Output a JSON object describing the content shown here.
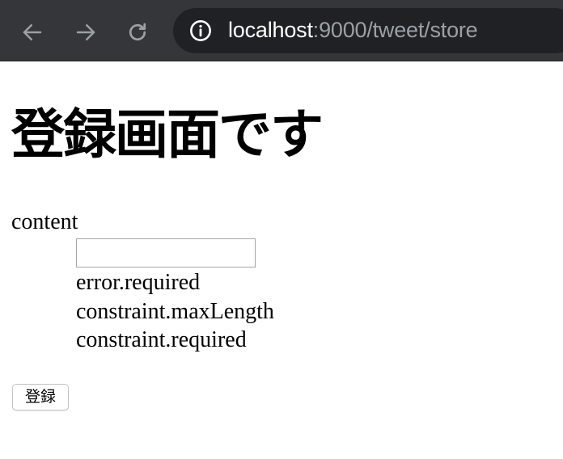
{
  "browser": {
    "url_host": "localhost",
    "url_rest": ":9000/tweet/store",
    "icons": {
      "back": "arrow-left-icon",
      "forward": "arrow-right-icon",
      "reload": "reload-icon",
      "site_info": "info-circle-icon"
    },
    "colors": {
      "toolbar": "#35363a",
      "omnibox": "#202124",
      "icon": "#9aa0a6"
    }
  },
  "page": {
    "title": "登録画面です",
    "form": {
      "field_label": "content",
      "input_value": "",
      "messages": [
        "error.required",
        "constraint.maxLength",
        "constraint.required"
      ],
      "submit_label": "登録"
    }
  }
}
